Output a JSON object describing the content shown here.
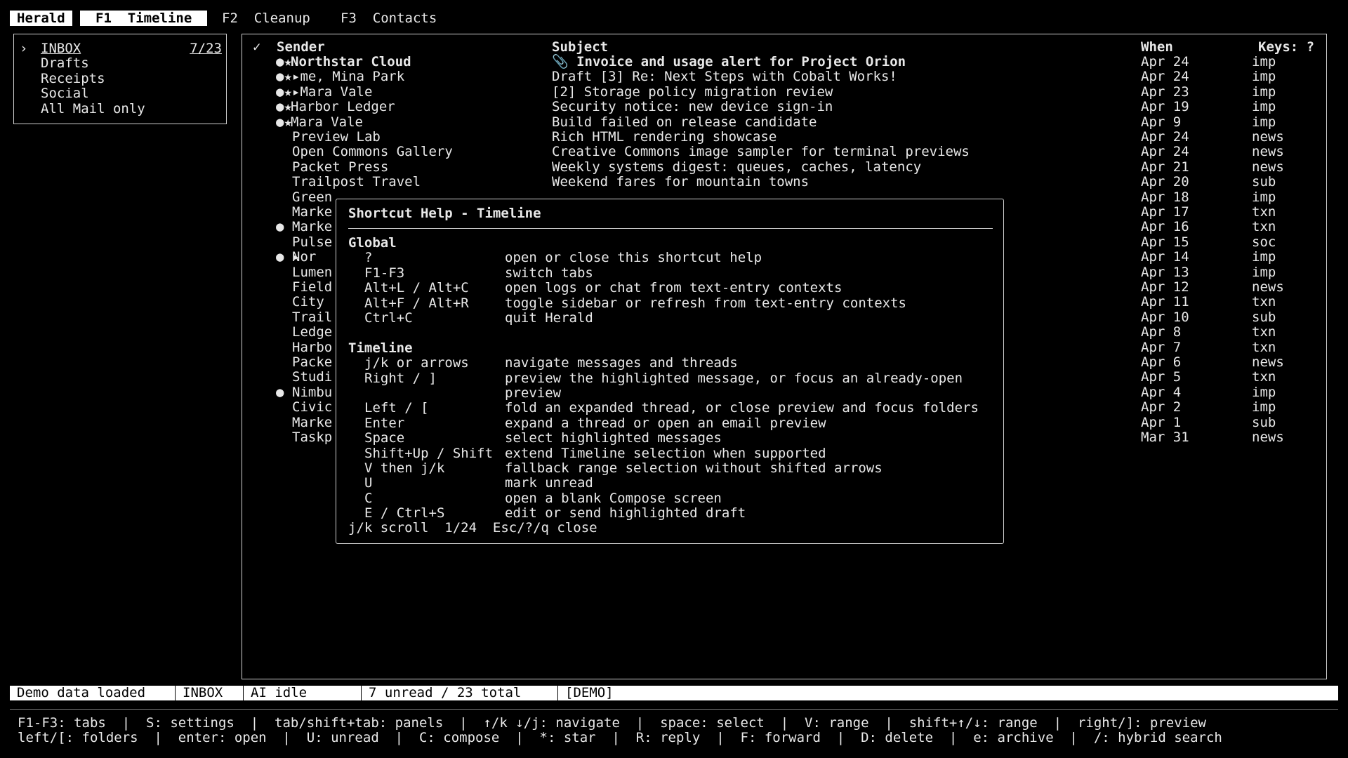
{
  "app": {
    "name": "Herald"
  },
  "tabs": [
    {
      "label": "F1  Timeline"
    },
    {
      "label": "F2  Cleanup"
    },
    {
      "label": "F3  Contacts"
    }
  ],
  "folders": [
    {
      "marker": "›",
      "label": "INBOX",
      "count": "7/23"
    },
    {
      "marker": "",
      "label": "Drafts",
      "count": ""
    },
    {
      "marker": "",
      "label": "Receipts",
      "count": ""
    },
    {
      "marker": "",
      "label": "Social",
      "count": ""
    },
    {
      "marker": "",
      "label": "All Mail only",
      "count": ""
    }
  ],
  "timeline": {
    "headers": {
      "check": "✓",
      "sender": "Sender",
      "subject": "Subject",
      "when": "When",
      "keys": "Keys: ?"
    },
    "rows": [
      {
        "flags": "●★",
        "sender": "Northstar Cloud",
        "subject": "📎 Invoice and usage alert for Project Orion",
        "when": "Apr 24",
        "tag": "imp",
        "bold": true
      },
      {
        "flags": "●★▸",
        "sender": " me, Mina Park",
        "subject": "Draft [3] Re: Next Steps with Cobalt Works!",
        "when": "Apr 24",
        "tag": "imp",
        "bold": false
      },
      {
        "flags": "●★▸",
        "sender": " Mara Vale",
        "subject": "[2] Storage policy migration review",
        "when": "Apr 23",
        "tag": "imp",
        "bold": false
      },
      {
        "flags": "●★",
        "sender": "Harbor Ledger",
        "subject": "Security notice: new device sign-in",
        "when": "Apr 19",
        "tag": "imp",
        "bold": false
      },
      {
        "flags": "●★",
        "sender": "Mara Vale",
        "subject": "Build failed on release candidate",
        "when": "Apr 9",
        "tag": "imp",
        "bold": false
      },
      {
        "flags": "",
        "sender": "Preview Lab",
        "subject": "Rich HTML rendering showcase",
        "when": "Apr 24",
        "tag": "news",
        "bold": false
      },
      {
        "flags": "",
        "sender": "Open Commons Gallery",
        "subject": "Creative Commons image sampler for terminal previews",
        "when": "Apr 24",
        "tag": "news",
        "bold": false
      },
      {
        "flags": "",
        "sender": "Packet Press",
        "subject": "Weekly systems digest: queues, caches, latency",
        "when": "Apr 21",
        "tag": "news",
        "bold": false
      },
      {
        "flags": "",
        "sender": "Trailpost Travel",
        "subject": "Weekend fares for mountain towns",
        "when": "Apr 20",
        "tag": "sub",
        "bold": false
      },
      {
        "flags": "",
        "sender": "Green",
        "subject": "",
        "when": "Apr 18",
        "tag": "imp",
        "bold": false
      },
      {
        "flags": "",
        "sender": "Marke",
        "subject": "",
        "when": "Apr 17",
        "tag": "txn",
        "bold": false
      },
      {
        "flags": "●",
        "sender": "Marke",
        "subject": "",
        "when": "Apr 16",
        "tag": "txn",
        "bold": false
      },
      {
        "flags": "",
        "sender": "Pulse",
        "subject": "",
        "when": "Apr 15",
        "tag": "soc",
        "bold": false
      },
      {
        "flags": "● ▸",
        "sender": "Nor",
        "subject": "",
        "when": "Apr 14",
        "tag": "imp",
        "bold": false
      },
      {
        "flags": "",
        "sender": "Lumen",
        "subject": "",
        "when": "Apr 13",
        "tag": "imp",
        "bold": false
      },
      {
        "flags": "",
        "sender": "Field",
        "subject": "",
        "when": "Apr 12",
        "tag": "news",
        "bold": false
      },
      {
        "flags": "",
        "sender": "City",
        "subject": "",
        "when": "Apr 11",
        "tag": "txn",
        "bold": false
      },
      {
        "flags": "",
        "sender": "Trail",
        "subject": "",
        "when": "Apr 10",
        "tag": "sub",
        "bold": false
      },
      {
        "flags": "",
        "sender": "Ledge",
        "subject": "",
        "when": "Apr 8",
        "tag": "txn",
        "bold": false
      },
      {
        "flags": "",
        "sender": "Harbo",
        "subject": "",
        "when": "Apr 7",
        "tag": "txn",
        "bold": false
      },
      {
        "flags": "",
        "sender": "Packe",
        "subject": "",
        "when": "Apr 6",
        "tag": "news",
        "bold": false
      },
      {
        "flags": "",
        "sender": "Studi",
        "subject": "",
        "when": "Apr 5",
        "tag": "txn",
        "bold": false
      },
      {
        "flags": "●",
        "sender": "Nimbu",
        "subject": "",
        "when": "Apr 4",
        "tag": "imp",
        "bold": false
      },
      {
        "flags": "",
        "sender": "Civic",
        "subject": "",
        "when": "Apr 2",
        "tag": "imp",
        "bold": false
      },
      {
        "flags": "",
        "sender": "Marke",
        "subject": "",
        "when": "Apr 1",
        "tag": "sub",
        "bold": false
      },
      {
        "flags": "",
        "sender": "Taskp",
        "subject": "",
        "when": "Mar 31",
        "tag": "news",
        "bold": false
      }
    ]
  },
  "help": {
    "title": "Shortcut Help - Timeline",
    "lines": [
      {
        "type": "heading",
        "text": "Global"
      },
      {
        "type": "item",
        "key": "?",
        "desc": "open or close this shortcut help"
      },
      {
        "type": "item",
        "key": "F1-F3",
        "desc": "switch tabs"
      },
      {
        "type": "item",
        "key": "Alt+L / Alt+C",
        "desc": "open logs or chat from text-entry contexts"
      },
      {
        "type": "item",
        "key": "Alt+F / Alt+R",
        "desc": "toggle sidebar or refresh from text-entry contexts"
      },
      {
        "type": "item",
        "key": "Ctrl+C",
        "desc": "quit Herald"
      },
      {
        "type": "blank",
        "text": ""
      },
      {
        "type": "heading",
        "text": "Timeline"
      },
      {
        "type": "item",
        "key": "j/k or arrows",
        "desc": "navigate messages and threads"
      },
      {
        "type": "item",
        "key": "Right / ]",
        "desc": "preview the highlighted message, or focus an already-open"
      },
      {
        "type": "item",
        "key": "",
        "desc": "preview"
      },
      {
        "type": "item",
        "key": "Left / [",
        "desc": "fold an expanded thread, or close preview and focus folders"
      },
      {
        "type": "item",
        "key": "Enter",
        "desc": "expand a thread or open an email preview"
      },
      {
        "type": "item",
        "key": "Space",
        "desc": "select highlighted messages"
      },
      {
        "type": "item",
        "key": "Shift+Up / Shift",
        "desc": "extend Timeline selection when supported"
      },
      {
        "type": "item",
        "key": "V then j/k",
        "desc": "fallback range selection without shifted arrows"
      },
      {
        "type": "item",
        "key": "U",
        "desc": "mark unread"
      },
      {
        "type": "item",
        "key": "C",
        "desc": "open a blank Compose screen"
      },
      {
        "type": "item",
        "key": "E / Ctrl+S",
        "desc": "edit or send highlighted draft"
      }
    ],
    "footer": "j/k scroll  1/24  Esc/?/q close"
  },
  "status": {
    "message": "Demo data loaded",
    "folder": "INBOX",
    "ai": "AI idle",
    "counts": "7 unread / 23 total",
    "mode": "[DEMO]"
  },
  "hints": {
    "line1": "F1-F3: tabs  |  S: settings  |  tab/shift+tab: panels  |  ↑/k ↓/j: navigate  |  space: select  |  V: range  |  shift+↑/↓: range  |  right/]: preview",
    "line2": "left/[: folders  |  enter: open  |  U: unread  |  C: compose  |  *: star  |  R: reply  |  F: forward  |  D: delete  |  e: archive  |  /: hybrid search"
  }
}
